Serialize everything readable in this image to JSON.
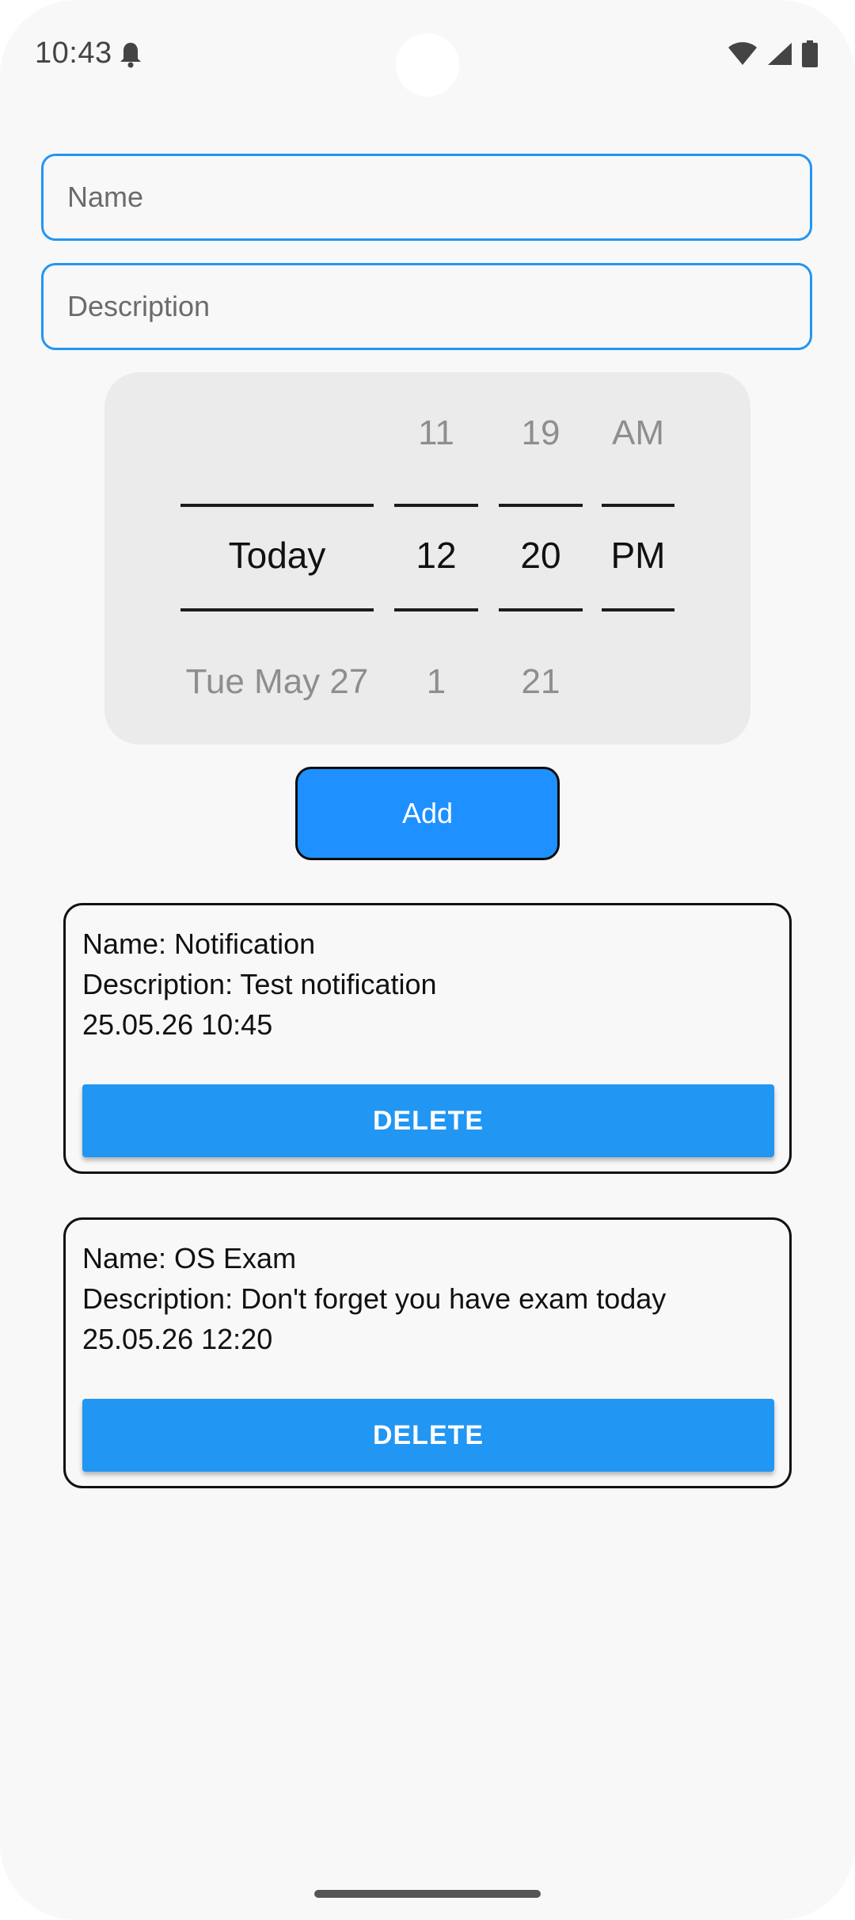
{
  "status_bar": {
    "time": "10:43",
    "icons": [
      "bell-icon",
      "wifi-icon",
      "signal-icon",
      "battery-icon"
    ]
  },
  "form": {
    "name_placeholder": "Name",
    "name_value": "",
    "description_placeholder": "Description",
    "description_value": ""
  },
  "picker": {
    "day": {
      "above": "",
      "selected": "Today",
      "below": "Tue May 27"
    },
    "hour": {
      "above": "11",
      "selected": "12",
      "below": "1"
    },
    "minute": {
      "above": "19",
      "selected": "20",
      "below": "21"
    },
    "ampm": {
      "above": "AM",
      "selected": "PM",
      "below": ""
    }
  },
  "add_button_label": "Add",
  "notifications": [
    {
      "name": "Name: Notification",
      "description": "Description: Test notification",
      "datetime": "25.05.26 10:45",
      "delete_label": "DELETE"
    },
    {
      "name": "Name: OS Exam",
      "description": "Description: Don't forget you have exam today",
      "datetime": "25.05.26 12:20",
      "delete_label": "DELETE"
    }
  ],
  "colors": {
    "accent": "#2196f3",
    "add_button": "#1e90ff",
    "background": "#f8f8f8",
    "picker_background": "#ebebeb"
  }
}
